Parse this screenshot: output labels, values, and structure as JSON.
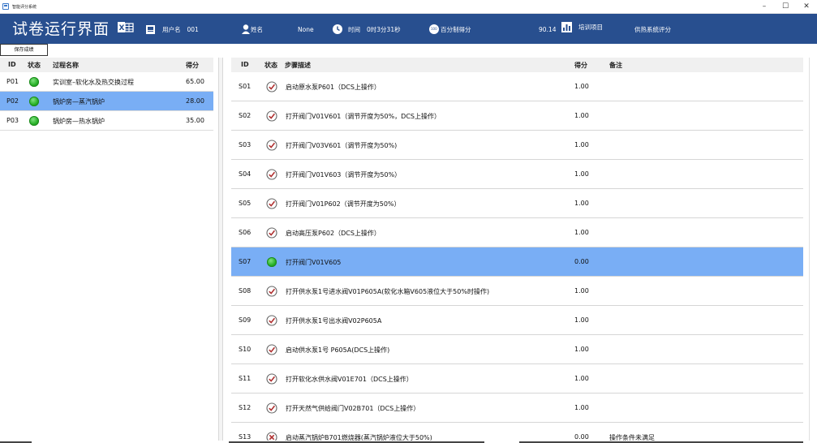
{
  "window": {
    "title": "智能评分系统",
    "minimize": "–",
    "maximize": "☐",
    "close": "✕"
  },
  "header": {
    "title": "试卷运行界面",
    "username_label": "用户名",
    "username_value": "001",
    "name_label": "姓名",
    "name_value": "None",
    "time_label": "时间",
    "time_value": "0时3分31秒",
    "percent_label": "百分制得分",
    "percent_value": "90.14",
    "training_label": "培训项目",
    "training_value": "供热系统评分",
    "percent_icon_text": "100"
  },
  "toolbar": {
    "save_label": "保存成绩"
  },
  "process_table": {
    "headers": {
      "id": "ID",
      "status": "状态",
      "name": "过程名称",
      "score": "得分"
    },
    "rows": [
      {
        "id": "P01",
        "name": "实训室–软化水及热交换过程",
        "score": "65.00",
        "selected": false
      },
      {
        "id": "P02",
        "name": "锅炉房—蒸汽锅炉",
        "score": "28.00",
        "selected": true
      },
      {
        "id": "P03",
        "name": "锅炉房—热水锅炉",
        "score": "35.00",
        "selected": false
      }
    ]
  },
  "step_table": {
    "headers": {
      "id": "ID",
      "status": "状态",
      "desc": "步骤描述",
      "score": "得分",
      "note": "备注"
    },
    "rows": [
      {
        "id": "S01",
        "status": "done",
        "desc": "启动原水泵P601（DCS上操作）",
        "score": "1.00",
        "note": ""
      },
      {
        "id": "S02",
        "status": "done",
        "desc": "打开阀门V01V601（调节开度为50%，DCS上操作）",
        "score": "1.00",
        "note": ""
      },
      {
        "id": "S03",
        "status": "done",
        "desc": "打开阀门V03V601（调节开度为50%)",
        "score": "1.00",
        "note": ""
      },
      {
        "id": "S04",
        "status": "done",
        "desc": "打开阀门V01V603（调节开度为50%）",
        "score": "1.00",
        "note": ""
      },
      {
        "id": "S05",
        "status": "done",
        "desc": "打开阀门V01P602（调节开度为50%）",
        "score": "1.00",
        "note": ""
      },
      {
        "id": "S06",
        "status": "done",
        "desc": "启动高压泵P602（DCS上操作）",
        "score": "1.00",
        "note": ""
      },
      {
        "id": "S07",
        "status": "active",
        "desc": "打开阀门V01V605",
        "score": "0.00",
        "note": ""
      },
      {
        "id": "S08",
        "status": "done",
        "desc": "打开供水泵1号进水阀V01P605A(软化水箱V605液位大于50%时操作)",
        "score": "1.00",
        "note": ""
      },
      {
        "id": "S09",
        "status": "done",
        "desc": "打开供水泵1号出水阀V02P605A",
        "score": "1.00",
        "note": ""
      },
      {
        "id": "S10",
        "status": "done",
        "desc": "启动供水泵1号 P605A(DCS上操作)",
        "score": "1.00",
        "note": ""
      },
      {
        "id": "S11",
        "status": "done",
        "desc": "打开软化水供水阀V01E701（DCS上操作）",
        "score": "1.00",
        "note": ""
      },
      {
        "id": "S12",
        "status": "done",
        "desc": "打开天然气供给阀门V02B701（DCS上操作）",
        "score": "1.00",
        "note": ""
      },
      {
        "id": "S13",
        "status": "failed",
        "desc": "启动蒸汽锅炉B701燃烧器(蒸汽锅炉液位大于50%)",
        "score": "0.00",
        "note": "操作条件未满足"
      }
    ]
  },
  "colors": {
    "header_bg": "#284f8f",
    "selected_row": "#79aef5",
    "status_green": "#27b027",
    "check_red": "#b03030"
  }
}
